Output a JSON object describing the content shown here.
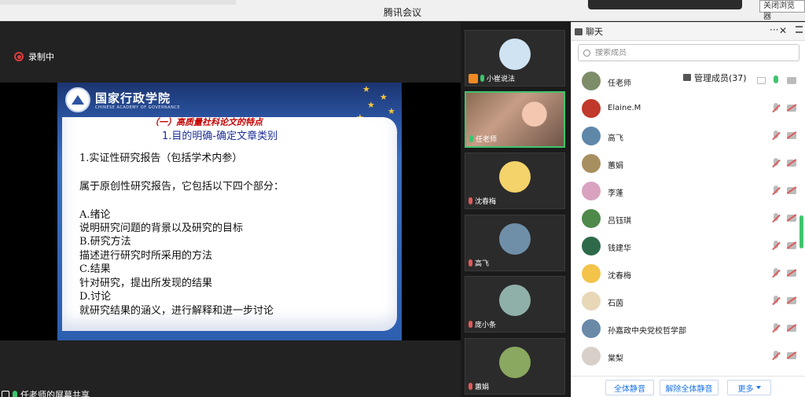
{
  "window": {
    "title": "腾讯会议",
    "close_browser": "关闭浏览器"
  },
  "recording": {
    "label": "录制中"
  },
  "slide": {
    "school_cn": "国家行政学院",
    "school_en": "CHINESE ACADEMY OF GOVERNANCE",
    "heading_red": "（一）高质量社科论文的特点",
    "heading_blue": "1.目的明确-确定文章类别",
    "lines": [
      "1.实证性研究报告（包括学术内参）",
      "属于原创性研究报告，它包括以下四个部分：",
      "A.绪论",
      "说明研究问题的背景以及研究的目标",
      "B.研究方法",
      "描述进行研究时所采用的方法",
      "C.结果",
      "针对研究，提出所发现的结果",
      "D.讨论",
      "就研究结果的涵义，进行解释和进一步讨论"
    ]
  },
  "share": {
    "label": "任老师的屏幕共享"
  },
  "videos": [
    {
      "name": "小崔说法",
      "mic": "on",
      "avatar_color": "#cfe3f3"
    },
    {
      "name": "任老师",
      "mic": "on",
      "camera": true
    },
    {
      "name": "沈春梅",
      "mic": "muted",
      "avatar_color": "#f3d36a"
    },
    {
      "name": "高飞",
      "mic": "muted",
      "avatar_color": "#6f8fa8"
    },
    {
      "name": "庞小条",
      "mic": "muted",
      "avatar_color": "#8fb0a8"
    },
    {
      "name": "蕙娟",
      "mic": "muted",
      "avatar_color": "#8aa860"
    }
  ],
  "panel": {
    "tab_chat": "聊天",
    "tab_members": "管理成员(37)",
    "tab_more": "···",
    "tab_close": "✕",
    "search_placeholder": "搜索成员",
    "members": [
      {
        "name": "任老师",
        "mic": "on",
        "cam": "off",
        "avatar_color": "#7d8d6a",
        "screen": true
      },
      {
        "name": "Elaine.M",
        "mic": "muted",
        "cam": "muted",
        "avatar_color": "#c0392b"
      },
      {
        "name": "高飞",
        "mic": "muted",
        "cam": "muted",
        "avatar_color": "#5f87a8"
      },
      {
        "name": "蕙娟",
        "mic": "muted",
        "cam": "muted",
        "avatar_color": "#a88f60"
      },
      {
        "name": "李蓬",
        "mic": "muted",
        "cam": "muted",
        "avatar_color": "#d9a3c0"
      },
      {
        "name": "吕钰琪",
        "mic": "muted",
        "cam": "muted",
        "avatar_color": "#4f8a4a"
      },
      {
        "name": "钱建华",
        "mic": "muted",
        "cam": "muted",
        "avatar_color": "#2e6a4a"
      },
      {
        "name": "沈春梅",
        "mic": "muted",
        "cam": "muted",
        "avatar_color": "#f3c34a"
      },
      {
        "name": "石茵",
        "mic": "muted",
        "cam": "muted",
        "avatar_color": "#e8d8b8"
      },
      {
        "name": "孙嘉政中央党校哲学部",
        "mic": "muted",
        "cam": "muted",
        "avatar_color": "#6a8aa8"
      },
      {
        "name": "棠梨",
        "mic": "muted",
        "cam": "muted",
        "avatar_color": "#d8d0c8"
      }
    ],
    "btn_mute_all": "全体静音",
    "btn_unmute_all": "解除全体静音",
    "btn_more": "更多"
  }
}
